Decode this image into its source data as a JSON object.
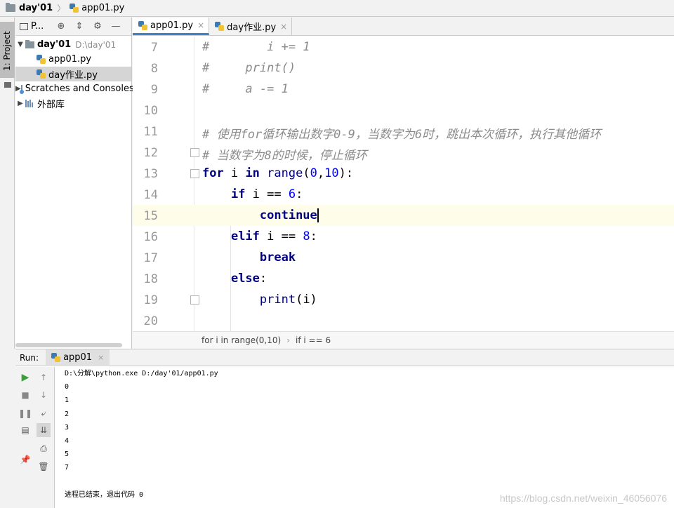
{
  "breadcrumb": {
    "project": "day'01",
    "file": "app01.py"
  },
  "left_strip": {
    "project_tab": "1: Project"
  },
  "project_panel": {
    "toolbar_label": "P...",
    "tree": [
      {
        "label": "day'01",
        "hint": "D:\\day'01",
        "type": "folder",
        "expanded": true
      },
      {
        "label": "app01.py",
        "type": "py"
      },
      {
        "label": "day作业.py",
        "type": "py",
        "selected": true
      },
      {
        "label": "Scratches and Consoles",
        "type": "scratch"
      },
      {
        "label": "外部库",
        "type": "lib"
      }
    ]
  },
  "editor": {
    "tabs": [
      {
        "label": "app01.py",
        "active": true
      },
      {
        "label": "day作业.py",
        "active": false
      }
    ],
    "lines": [
      {
        "n": "7",
        "text": "#        i += 1",
        "kind": "comment"
      },
      {
        "n": "8",
        "text": "#     print()",
        "kind": "comment"
      },
      {
        "n": "9",
        "text": "#     a -= 1",
        "kind": "comment"
      },
      {
        "n": "10",
        "text": "",
        "kind": "blank"
      },
      {
        "n": "11",
        "text": "# 使用for循环输出数字0-9，当数字为6时，跳出本次循环，执行其他循环",
        "kind": "comment"
      },
      {
        "n": "12",
        "text": "# 当数字为8的时候，停止循环",
        "kind": "comment"
      },
      {
        "n": "13",
        "text": "for i in range(0,10):",
        "kind": "for"
      },
      {
        "n": "14",
        "text": "    if i == 6:",
        "kind": "if"
      },
      {
        "n": "15",
        "text": "        continue",
        "kind": "continue"
      },
      {
        "n": "16",
        "text": "    elif i == 8:",
        "kind": "elif"
      },
      {
        "n": "17",
        "text": "        break",
        "kind": "break"
      },
      {
        "n": "18",
        "text": "    else:",
        "kind": "else"
      },
      {
        "n": "19",
        "text": "        print(i)",
        "kind": "print"
      },
      {
        "n": "20",
        "text": "",
        "kind": "blank"
      }
    ],
    "code_breadcrumb": [
      "for i in range(0,10)",
      "if i == 6"
    ]
  },
  "run_panel": {
    "label": "Run:",
    "tab": "app01",
    "console": [
      "D:\\分解\\python.exe D:/day'01/app01.py",
      "0",
      "1",
      "2",
      "3",
      "4",
      "5",
      "7",
      "",
      "进程已结束，退出代码 0"
    ]
  },
  "watermark": "https://blog.csdn.net/weixin_46056076"
}
